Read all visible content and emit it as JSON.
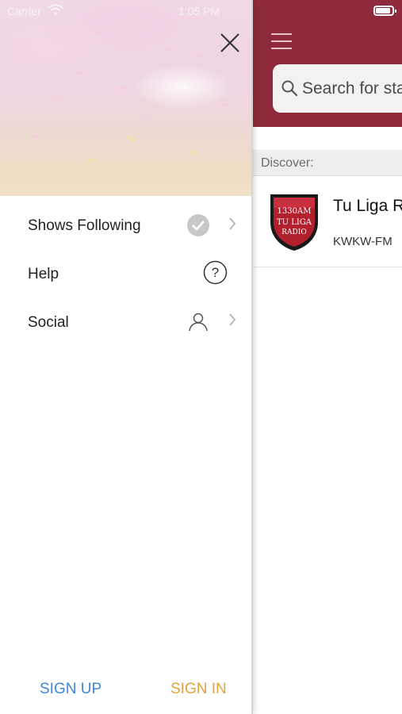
{
  "status_bar": {
    "carrier": "Carrier",
    "time": "1:05 PM"
  },
  "drawer": {
    "menu": [
      {
        "label": "Shows Following",
        "icon": "check-circle-icon"
      },
      {
        "label": "Help",
        "icon": "question-circle-icon"
      },
      {
        "label": "Social",
        "icon": "person-icon"
      }
    ],
    "footer": {
      "sign_up": "SIGN UP",
      "sign_in": "SIGN IN"
    }
  },
  "main": {
    "search_placeholder": "Search for sta",
    "discover_label": "Discover:",
    "stations": [
      {
        "name": "Tu Liga R",
        "call_sign": "KWKW-FM",
        "logo_text": [
          "1330AM",
          "TU LIGA",
          "RADIO"
        ]
      }
    ]
  },
  "colors": {
    "header": "#8f2a3c",
    "sign_up": "#3f87d4",
    "sign_in": "#e7a13a"
  }
}
